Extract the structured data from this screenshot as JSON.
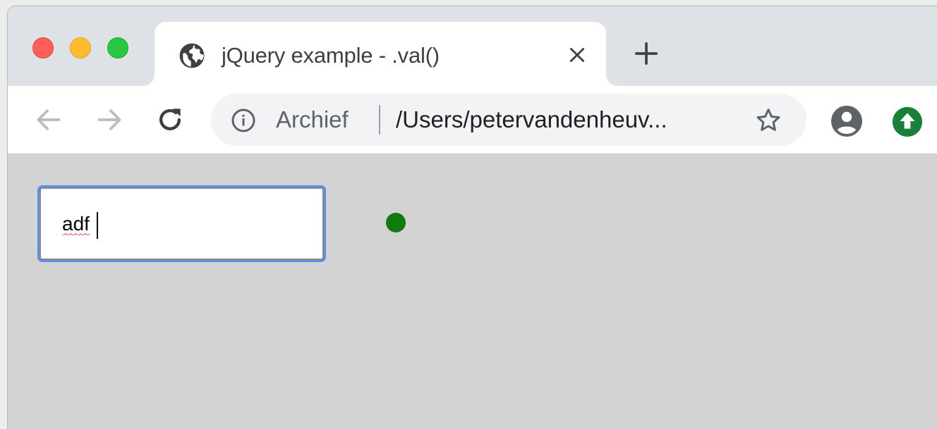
{
  "tab": {
    "title": "jQuery example - .val()",
    "favicon": "globe-icon"
  },
  "toolbar": {
    "back_icon": "arrow-left-icon",
    "forward_icon": "arrow-right-icon",
    "reload_icon": "reload-icon"
  },
  "omnibox": {
    "security_label": "Archief",
    "url": "/Users/petervandenheuv...",
    "info_icon": "info-icon",
    "bookmark_icon": "star-icon"
  },
  "page": {
    "input_value": "adf",
    "status_dot_color": "#107c10"
  },
  "colors": {
    "focus_ring": "#5b8fe8",
    "extension": "#188038"
  }
}
